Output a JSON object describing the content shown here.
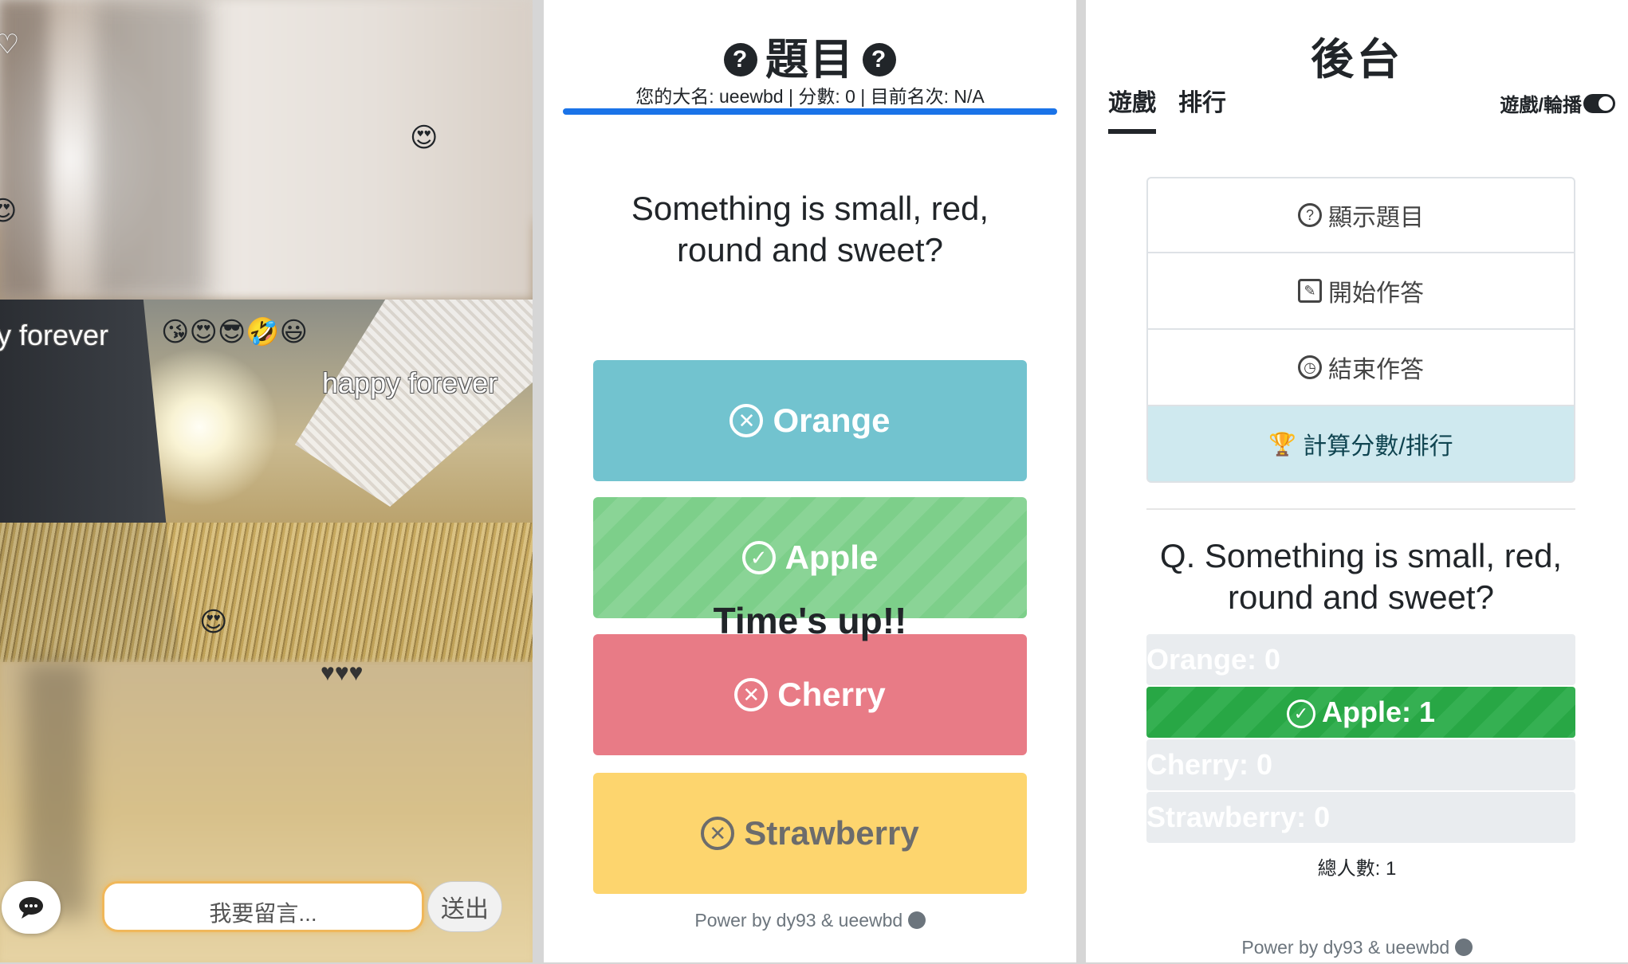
{
  "chat": {
    "danmaku": [
      "y forever",
      "happy forever"
    ],
    "emoji_row": "😘😍😎🤣😃",
    "emoji_single": "😍",
    "hearts": "♥♥♥",
    "heart_white": "♡",
    "input_placeholder": "我要留言...",
    "send_label": "送出"
  },
  "quiz": {
    "title": "題目",
    "qmark": "?",
    "status": "您的大名: ueewbd | 分數: 0 | 目前名次: N/A",
    "progress_percent": 100,
    "question": "Something is small, red, round and sweet?",
    "options": [
      {
        "label": "Orange",
        "icon": "x-circle-icon",
        "glyph": "✕"
      },
      {
        "label": "Apple",
        "icon": "check-circle-icon",
        "glyph": "✓"
      },
      {
        "label": "Cherry",
        "icon": "x-circle-icon",
        "glyph": "✕"
      },
      {
        "label": "Strawberry",
        "icon": "x-circle-icon",
        "glyph": "✕"
      }
    ],
    "overlay": "Time's up!!",
    "footer": "Power by dy93 & ueewbd"
  },
  "admin": {
    "title": "後台",
    "tabs": [
      "遊戲",
      "排行"
    ],
    "toggle_label": "遊戲/輪播",
    "buttons": [
      {
        "label": "顯示題目",
        "glyph": "?"
      },
      {
        "label": "開始作答",
        "glyph": "✎"
      },
      {
        "label": "結束作答",
        "glyph": "◷"
      },
      {
        "label": "計算分數/排行",
        "glyph": "🏆"
      }
    ],
    "question": "Q. Something is small, red, round and sweet?",
    "results": [
      {
        "label": "Orange: 0",
        "count": 0
      },
      {
        "label": "Apple: 1",
        "count": 1
      },
      {
        "label": "Cherry: 0",
        "count": 0
      },
      {
        "label": "Strawberry: 0",
        "count": 0
      }
    ],
    "results_check": "✓",
    "total": "總人數: 1",
    "footer": "Power by dy93 & ueewbd"
  },
  "colors": {
    "option_orange": "#72c3cf",
    "option_apple": "#7dcf8a",
    "option_cherry": "#e87b86",
    "option_strawberry": "#fdd56e",
    "progress": "#1a73e8",
    "result_correct": "#28a745",
    "score_button": "#cfe9ef"
  }
}
